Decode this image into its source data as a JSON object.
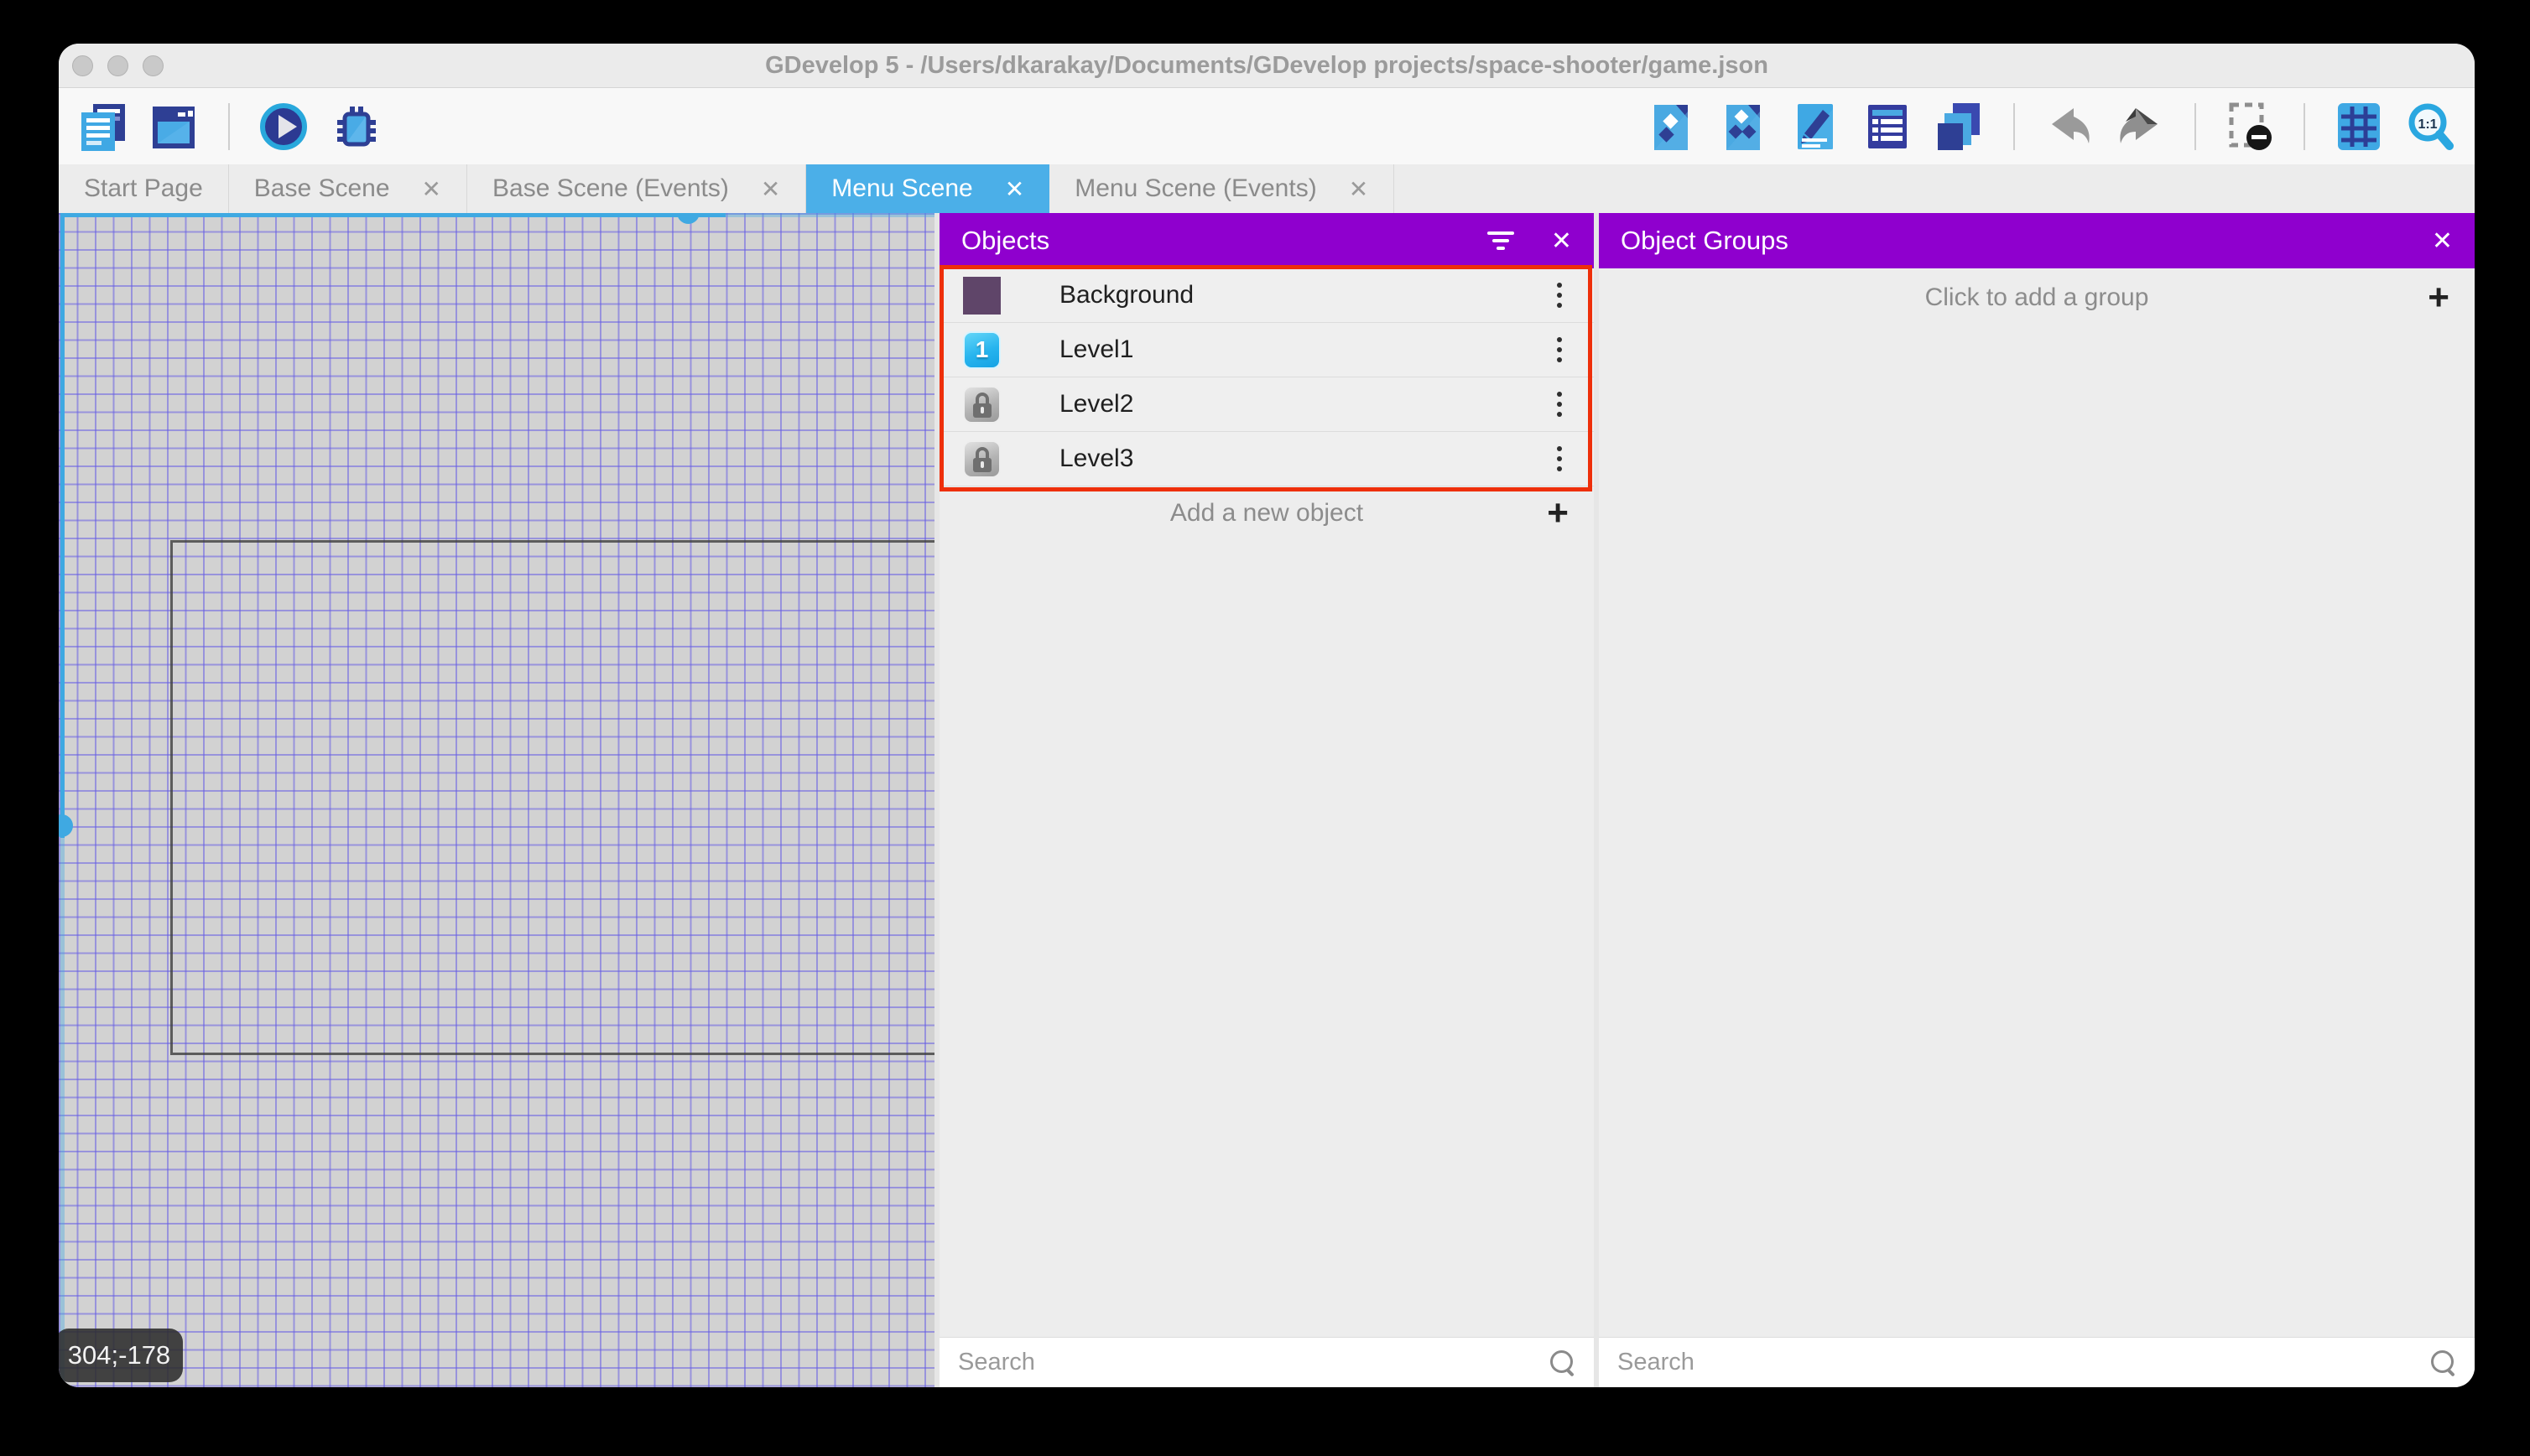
{
  "window": {
    "title": "GDevelop 5 - /Users/dkarakay/Documents/GDevelop projects/space-shooter/game.json"
  },
  "toolbar": {
    "left_icons": [
      "project-manager-icon",
      "start-page-icon",
      "preview-icon",
      "debug-icon"
    ],
    "right_icons": [
      "objects-panel-icon",
      "object-groups-icon",
      "properties-icon",
      "instances-list-icon",
      "layers-icon",
      "undo-icon",
      "redo-icon",
      "window-mask-icon",
      "grid-icon",
      "zoom-reset-icon"
    ],
    "zoom_ratio_label": "1:1"
  },
  "tabs": [
    {
      "label": "Start Page",
      "closable": false,
      "active": false
    },
    {
      "label": "Base Scene",
      "closable": true,
      "active": false
    },
    {
      "label": "Base Scene (Events)",
      "closable": true,
      "active": false
    },
    {
      "label": "Menu Scene",
      "closable": true,
      "active": true
    },
    {
      "label": "Menu Scene (Events)",
      "closable": true,
      "active": false
    }
  ],
  "ui": {
    "close_glyph": "✕",
    "plus_glyph": "+"
  },
  "canvas": {
    "coordinate_badge": "304;-178"
  },
  "objects_panel": {
    "title": "Objects",
    "items": [
      {
        "label": "Background",
        "icon": "background-thumbnail"
      },
      {
        "label": "Level1",
        "icon": "level1-button-thumbnail",
        "badge": "1"
      },
      {
        "label": "Level2",
        "icon": "locked-button-thumbnail"
      },
      {
        "label": "Level3",
        "icon": "locked-button-thumbnail"
      }
    ],
    "add_label": "Add a new object",
    "search_placeholder": "Search"
  },
  "object_groups_panel": {
    "title": "Object Groups",
    "add_label": "Click to add a group",
    "search_placeholder": "Search"
  },
  "colors": {
    "panel_header_purple": "#8f00ce",
    "active_tab_blue": "#4bafe8",
    "selection_cyan": "#3fa9e2",
    "tutorial_highlight_red": "#ee2f0a",
    "grid_line": "#675fe4",
    "canvas_background": "#d2d2d2"
  }
}
